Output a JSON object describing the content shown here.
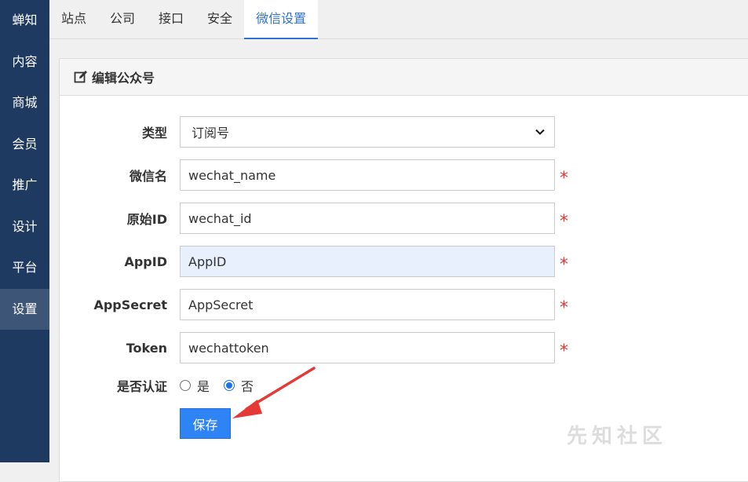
{
  "sidebar": {
    "items": [
      {
        "label": "蝉知"
      },
      {
        "label": "内容"
      },
      {
        "label": "商城"
      },
      {
        "label": "会员"
      },
      {
        "label": "推广"
      },
      {
        "label": "设计"
      },
      {
        "label": "平台"
      },
      {
        "label": "设置"
      }
    ],
    "active_index": 7
  },
  "tabs": [
    {
      "label": "站点"
    },
    {
      "label": "公司"
    },
    {
      "label": "接口"
    },
    {
      "label": "安全"
    },
    {
      "label": "微信设置"
    }
  ],
  "active_tab": 4,
  "panel": {
    "title": "编辑公众号",
    "type": {
      "label": "类型",
      "value": "订阅号"
    },
    "name": {
      "label": "微信名",
      "value": "wechat_name"
    },
    "orig_id": {
      "label": "原始ID",
      "value": "wechat_id"
    },
    "app_id": {
      "label": "AppID",
      "value": "AppID"
    },
    "app_secret": {
      "label": "AppSecret",
      "value": "AppSecret"
    },
    "token": {
      "label": "Token",
      "value": "wechattoken"
    },
    "certified": {
      "label": "是否认证",
      "yes": "是",
      "no": "否",
      "selected": "否"
    },
    "required_mark": "*",
    "save_label": "保存"
  },
  "watermark": "先知社区",
  "colors": {
    "sidebar_bg": "#1f3a60",
    "accent": "#2f73d8",
    "button": "#2f84f5",
    "required": "#e53935",
    "arrow": "#e53935"
  }
}
